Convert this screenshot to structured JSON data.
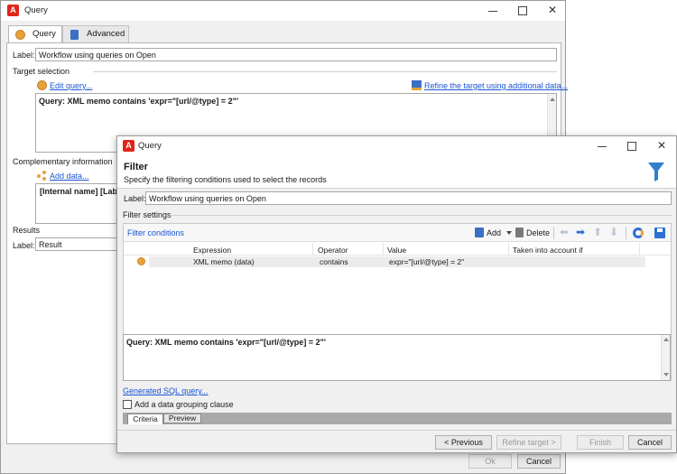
{
  "back_window": {
    "title": "Query",
    "tabs": [
      {
        "label": "Query"
      },
      {
        "label": "Advanced"
      }
    ],
    "label_caption": "Label:",
    "label_value": "Workflow using queries on Open",
    "target_section": "Target selection",
    "edit_query_link": "Edit query...",
    "refine_link": "Refine the target using additional data...",
    "query_text": "Query: XML memo contains 'expr=\"[url/@type] = 2\"'",
    "complementary_section": "Complementary information",
    "add_data_link": "Add data...",
    "columns_text": "[Internal name]  [Label]",
    "results_section": "Results",
    "results_label_caption": "Label:",
    "results_label_value": "Result",
    "ok_button": "Ok",
    "cancel_button": "Cancel"
  },
  "front_window": {
    "title": "Query",
    "heading": "Filter",
    "subheading": "Specify the filtering conditions used to select the records",
    "label_caption": "Label:",
    "label_value": "Workflow using queries on Open",
    "filter_settings": "Filter settings",
    "filter_conditions_link": "Filter conditions",
    "toolbar": {
      "add": "Add",
      "delete": "Delete"
    },
    "grid": {
      "columns": [
        "Expression",
        "Operator",
        "Value",
        "Taken into account if"
      ],
      "rows": [
        {
          "expression": "XML memo (data)",
          "operator": "contains",
          "value": "expr=\"[url/@type] = 2\"",
          "condition": ""
        }
      ]
    },
    "query_text": "Query: XML memo contains 'expr=\"[url/@type] = 2\"'",
    "sql_link": "Generated SQL query...",
    "grouping_checkbox_label": "Add a data grouping clause",
    "bottom_tabs": [
      {
        "label": "Criteria"
      },
      {
        "label": "Preview"
      }
    ],
    "buttons": {
      "previous": "< Previous",
      "refine": "Refine target >",
      "finish": "Finish",
      "cancel": "Cancel"
    }
  },
  "colors": {
    "accent_link": "#1a55d6",
    "brand_red": "#e1251b",
    "filter_funnel": "#2f7fd0",
    "status_dot": "#e8a23a"
  }
}
